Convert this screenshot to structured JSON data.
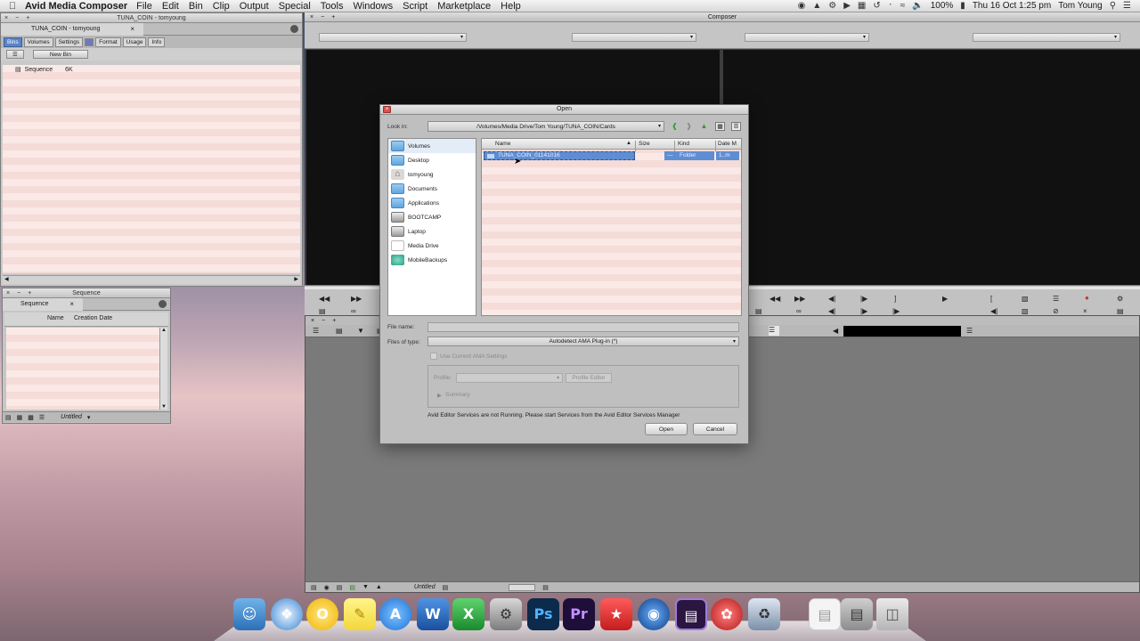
{
  "menubar": {
    "apple": "",
    "app_name": "Avid Media Composer",
    "menus": [
      "File",
      "Edit",
      "Bin",
      "Clip",
      "Output",
      "Special",
      "Tools",
      "Windows",
      "Script",
      "Marketplace",
      "Help"
    ],
    "battery": "100%",
    "datetime": "Thu 16 Oct  1:25 pm",
    "user": "Tom Young"
  },
  "bin_window": {
    "title": "TUNA_COIN - tomyoung",
    "tab_label": "TUNA_COIN - tomyoung",
    "tabs": [
      "Bins",
      "Volumes",
      "Settings",
      "Format",
      "Usage",
      "Info"
    ],
    "new_bin_label": "New Bin",
    "items": [
      {
        "name": "Sequence",
        "size": "6K"
      }
    ]
  },
  "sequence_window": {
    "title": "Sequence",
    "tab_label": "Sequence",
    "columns": [
      "Name",
      "Creation Date"
    ],
    "footer_label": "Untitled"
  },
  "composer": {
    "title": "Composer"
  },
  "timeline": {
    "footer_label": "Untitled"
  },
  "open_dialog": {
    "title": "Open",
    "look_in_label": "Look in:",
    "path": "/Volumes/Media Drive/Tom Young/TUNA_COIN/Cards",
    "places": [
      {
        "label": "Volumes",
        "icon": "folder-icon"
      },
      {
        "label": "Desktop",
        "icon": "folder-icon"
      },
      {
        "label": "tomyoung",
        "icon": "home-icon"
      },
      {
        "label": "Documents",
        "icon": "folder-icon"
      },
      {
        "label": "Applications",
        "icon": "folder-icon"
      },
      {
        "label": "BOOTCAMP",
        "icon": "disk-icon"
      },
      {
        "label": "Laptop",
        "icon": "disk-icon"
      },
      {
        "label": "Media Drive",
        "icon": "drive-icon"
      },
      {
        "label": "MobileBackups",
        "icon": "time-machine-icon"
      }
    ],
    "columns": {
      "name": "Name",
      "size": "Size",
      "kind": "Kind",
      "date": "Date M"
    },
    "files": [
      {
        "name": "TUNA_COIN_01141016",
        "size": "—",
        "kind": "Folder",
        "date": "1..m"
      }
    ],
    "file_name_label": "File name:",
    "file_name_value": "",
    "files_of_type_label": "Files of type:",
    "files_of_type_value": "Autodetect AMA Plug-in (*)",
    "use_current_settings": "Use Current AMA Settings",
    "profile_label": "Profile:",
    "profile_editor_label": "Profile Editor",
    "summary_label": "Summary",
    "status_message": "Avid Editor Services are not Running. Please start Services from the Avid Editor Services Manager",
    "open_button": "Open",
    "cancel_button": "Cancel"
  },
  "colors": {
    "selection": "#5f8dd3",
    "active_tab": "#5b83c4",
    "close_button": "#d8534f"
  }
}
